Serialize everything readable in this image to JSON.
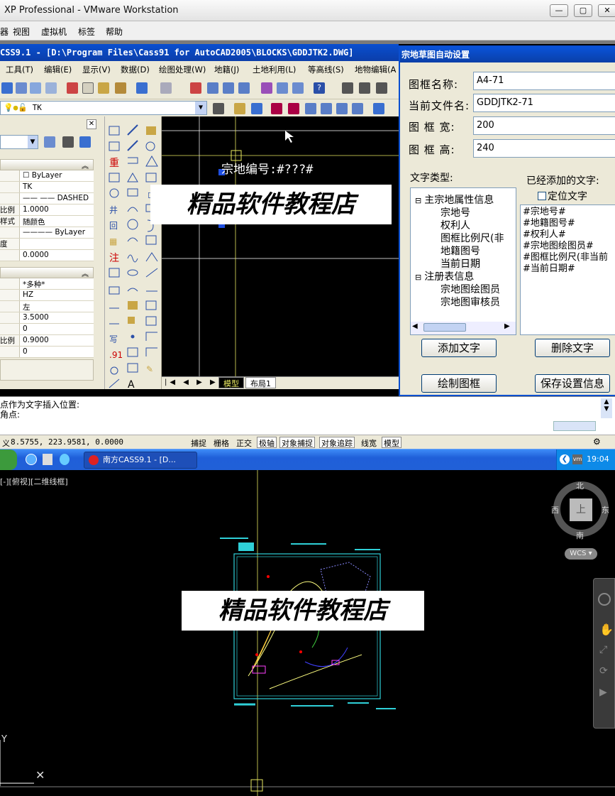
{
  "vm": {
    "title": "XP Professional - VMware Workstation",
    "menu": [
      "视图",
      "虚拟机",
      "标签",
      "帮助"
    ],
    "menu_partial": "器"
  },
  "cad": {
    "title": "CSS9.1 - [D:\\Program Files\\Cass91 for AutoCAD2005\\BLOCKS\\GDDJTK2.DWG]",
    "menu": [
      "工具(T)",
      "编辑(E)",
      "显示(V)",
      "数据(D)",
      "绘图处理(W)",
      "地籍(J)",
      "土地利用(L)",
      "等高线(S)",
      "地物编辑(A"
    ],
    "layer_name": "TK",
    "props_general": [
      {
        "label": "",
        "value": "☐ ByLayer"
      },
      {
        "label": "",
        "value": "TK"
      },
      {
        "label": "",
        "value": "—— —— DASHED"
      },
      {
        "label": "比例",
        "value": "1.0000"
      },
      {
        "label": "样式",
        "value": "随颜色"
      },
      {
        "label": "",
        "value": "———— ByLayer"
      },
      {
        "label": "度",
        "value": ""
      },
      {
        "label": "",
        "value": "0.0000"
      }
    ],
    "props_text": [
      {
        "label": "",
        "value": "*多种*"
      },
      {
        "label": "",
        "value": "HZ"
      },
      {
        "label": "",
        "value": "左"
      },
      {
        "label": "",
        "value": "3.5000"
      },
      {
        "label": "",
        "value": "0"
      },
      {
        "label": "比例",
        "value": "0.9000"
      },
      {
        "label": "",
        "value": "0"
      }
    ],
    "canvas_text": "宗地编号:#???#",
    "tabs": [
      "模型",
      "布局1"
    ],
    "command_lines": [
      "点作为文字插入位置:",
      "角点:"
    ],
    "coords": "8.5755, 223.9581, 0.0000",
    "coords_prefix": "义",
    "status_buttons": [
      "捕捉",
      "栅格",
      "正交",
      "极轴",
      "对象捕捉",
      "对象追踪",
      "线宽",
      "模型"
    ]
  },
  "dialog": {
    "title": "宗地草图自动设置",
    "frame_name_label": "图框名称:",
    "frame_name_value": "A4-71",
    "file_name_label": "当前文件名:",
    "file_name_value": "GDDJTK2-71",
    "width_label": "图 框 宽:",
    "width_value": "200",
    "height_label": "图 框 高:",
    "height_value": "240",
    "text_type_label": "文字类型:",
    "added_label": "已经添加的文字:",
    "position_label": "定位文字",
    "tree": [
      {
        "label": "主宗地属性信息",
        "level": 0,
        "exp": "⊟"
      },
      {
        "label": "宗地号",
        "level": 1
      },
      {
        "label": "权利人",
        "level": 1
      },
      {
        "label": "图框比例尺(非",
        "level": 1
      },
      {
        "label": "地籍图号",
        "level": 1
      },
      {
        "label": "当前日期",
        "level": 1
      },
      {
        "label": "注册表信息",
        "level": 0,
        "exp": "⊟"
      },
      {
        "label": "宗地图绘图员",
        "level": 1
      },
      {
        "label": "宗地图审核员",
        "level": 1
      }
    ],
    "added_items": [
      "#宗地号#",
      "#地籍图号#",
      "#权利人#",
      "#宗地图绘图员#",
      "#图框比例尺(非当前",
      "#当前日期#"
    ],
    "add_btn": "添加文字",
    "delete_btn": "删除文字",
    "draw_btn": "绘制图框",
    "save_btn": "保存设置信息"
  },
  "taskbar": {
    "task": "南方CASS9.1 - [D...",
    "time": "19:04"
  },
  "viewport": {
    "label": "[-][俯视][二维线框]",
    "compass": {
      "n": "北",
      "s": "南",
      "e": "东",
      "w": "西",
      "top": "上"
    },
    "wcs": "WCS",
    "y_axis": "Y"
  },
  "watermark": "精品软件教程店"
}
